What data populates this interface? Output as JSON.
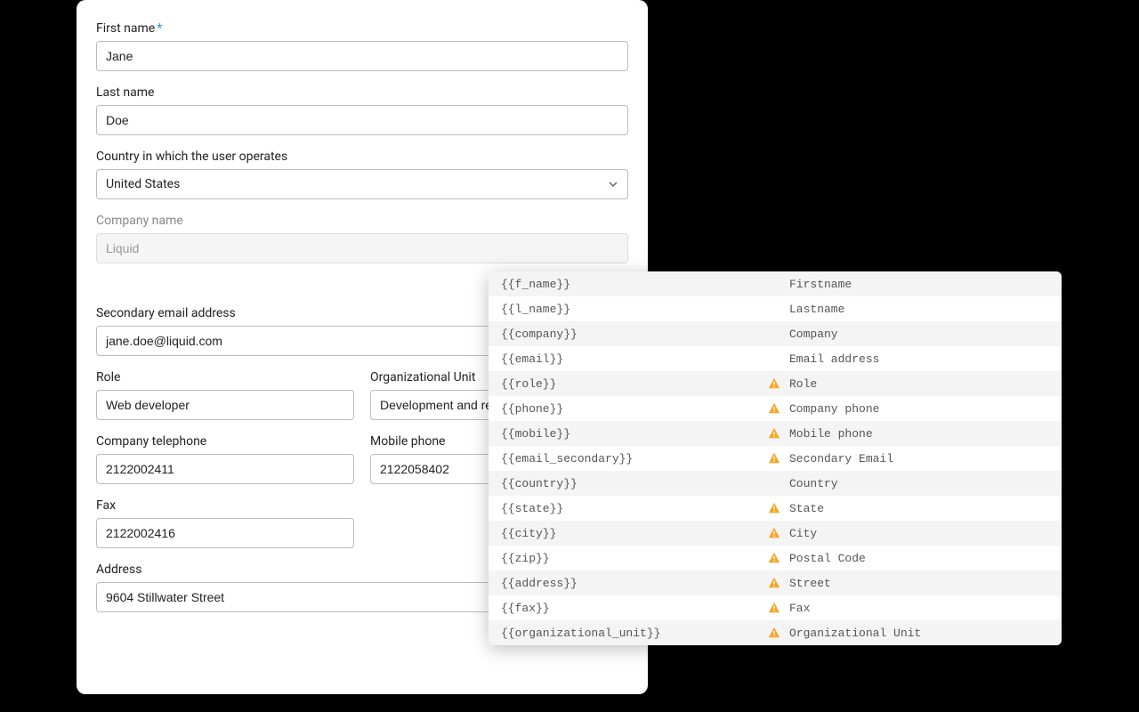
{
  "form": {
    "first_name": {
      "label": "First name",
      "value": "Jane",
      "required": true
    },
    "last_name": {
      "label": "Last name",
      "value": "Doe"
    },
    "country": {
      "label": "Country in which the user operates",
      "value": "United States"
    },
    "company": {
      "label": "Company name",
      "value": "Liquid",
      "disabled": true
    },
    "secondary_email": {
      "label": "Secondary email address",
      "value": "jane.doe@liquid.com"
    },
    "role": {
      "label": "Role",
      "value": "Web developer"
    },
    "org_unit": {
      "label": "Organizational Unit",
      "value": "Development and research"
    },
    "company_phone": {
      "label": "Company telephone",
      "value": "2122002411"
    },
    "mobile_phone": {
      "label": "Mobile phone",
      "value": "2122058402"
    },
    "fax": {
      "label": "Fax",
      "value": "2122002416"
    },
    "address": {
      "label": "Address",
      "value": "9604 Stillwater Street"
    }
  },
  "variables": [
    {
      "token": "{{f_name}}",
      "label": "Firstname",
      "warn": false
    },
    {
      "token": "{{l_name}}",
      "label": "Lastname",
      "warn": false
    },
    {
      "token": "{{company}}",
      "label": "Company",
      "warn": false
    },
    {
      "token": "{{email}}",
      "label": "Email address",
      "warn": false
    },
    {
      "token": "{{role}}",
      "label": "Role",
      "warn": true
    },
    {
      "token": "{{phone}}",
      "label": "Company phone",
      "warn": true
    },
    {
      "token": "{{mobile}}",
      "label": "Mobile phone",
      "warn": true
    },
    {
      "token": "{{email_secondary}}",
      "label": "Secondary Email",
      "warn": true
    },
    {
      "token": "{{country}}",
      "label": "Country",
      "warn": false
    },
    {
      "token": "{{state}}",
      "label": "State",
      "warn": true
    },
    {
      "token": "{{city}}",
      "label": "City",
      "warn": true
    },
    {
      "token": "{{zip}}",
      "label": "Postal Code",
      "warn": true
    },
    {
      "token": "{{address}}",
      "label": "Street",
      "warn": true
    },
    {
      "token": "{{fax}}",
      "label": "Fax",
      "warn": true
    },
    {
      "token": "{{organizational_unit}}",
      "label": "Organizational Unit",
      "warn": true
    }
  ]
}
